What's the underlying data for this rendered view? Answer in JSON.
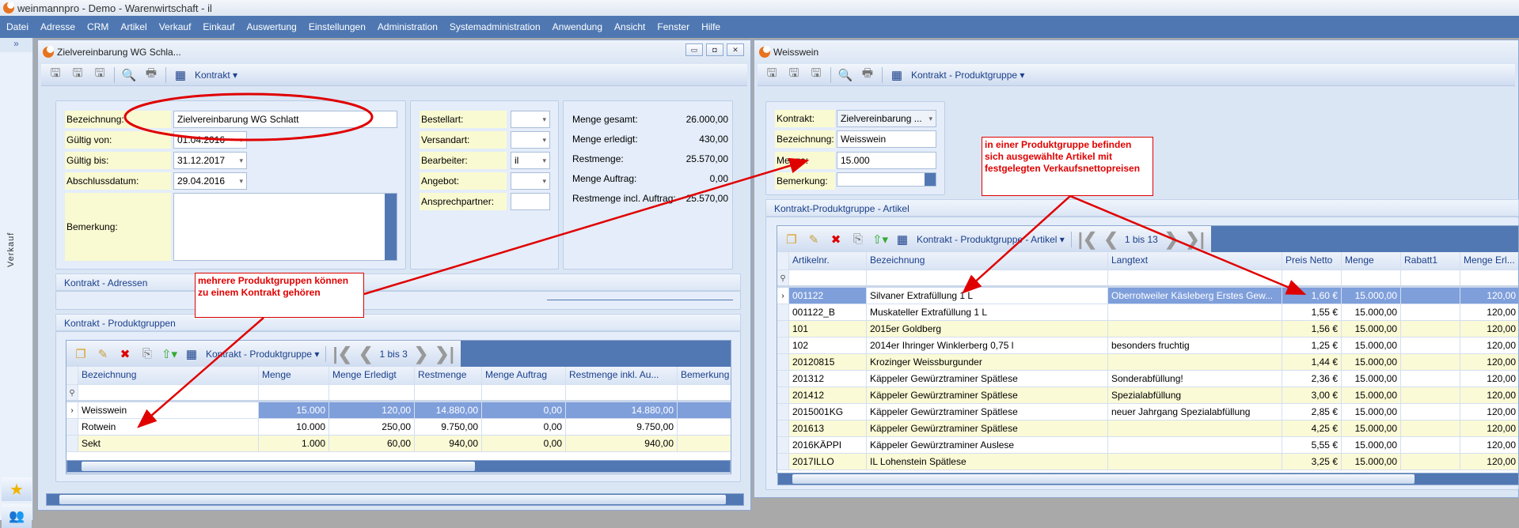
{
  "app": {
    "title": "weinmannpro - Demo - Warenwirtschaft - il"
  },
  "menu": [
    "Datei",
    "Adresse",
    "CRM",
    "Artikel",
    "Verkauf",
    "Einkauf",
    "Auswertung",
    "Einstellungen",
    "Administration",
    "Systemadministration",
    "Anwendung",
    "Ansicht",
    "Fenster",
    "Hilfe"
  ],
  "sidebar": {
    "expand": "»",
    "label": "Verkauf"
  },
  "colors": {
    "menubar": "#4f78b2",
    "selected_row": "#7f9fdb",
    "label_bg": "#fafad2",
    "annotation": "#e00000"
  },
  "left_window": {
    "title": "Zielvereinbarung WG Schla...",
    "toolbar_view": "Kontrakt",
    "form": {
      "bezeichnung_label": "Bezeichnung:",
      "bezeichnung": "Zielvereinbarung WG Schlatt",
      "gueltig_von_label": "Gültig von:",
      "gueltig_von": "01.04.2016",
      "gueltig_bis_label": "Gültig bis:",
      "gueltig_bis": "31.12.2017",
      "abschluss_label": "Abschlussdatum:",
      "abschluss": "29.04.2016",
      "bemerkung_label": "Bemerkung:"
    },
    "form2": {
      "bestellart": "Bestellart:",
      "versandart": "Versandart:",
      "bearbeiter": "Bearbeiter:",
      "bearbeiter_value": "il",
      "angebot": "Angebot:",
      "ansprechpartner": "Ansprechpartner:"
    },
    "summary": [
      {
        "label": "Menge gesamt:",
        "value": "26.000,00"
      },
      {
        "label": "Menge erledigt:",
        "value": "430,00"
      },
      {
        "label": "Restmenge:",
        "value": "25.570,00"
      },
      {
        "label": "Menge Auftrag:",
        "value": "0,00"
      },
      {
        "label": "Restmenge incl. Auftrag:",
        "value": "25.570,00"
      }
    ],
    "adressen_header": "Kontrakt - Adressen",
    "produktgruppen_header": "Kontrakt - Produktgruppen",
    "grid_view": "Kontrakt - Produktgruppe",
    "grid_paging": "1 bis 3",
    "columns": [
      "Bezeichnung",
      "Menge",
      "Menge Erledigt",
      "Restmenge",
      "Menge Auftrag",
      "Restmenge inkl. Au...",
      "Bemerkung"
    ],
    "rows": [
      [
        "Weisswein",
        "15.000",
        "120,00",
        "14.880,00",
        "0,00",
        "14.880,00",
        ""
      ],
      [
        "Rotwein",
        "10.000",
        "250,00",
        "9.750,00",
        "0,00",
        "9.750,00",
        ""
      ],
      [
        "Sekt",
        "1.000",
        "60,00",
        "940,00",
        "0,00",
        "940,00",
        ""
      ]
    ]
  },
  "right_window": {
    "title": "Weisswein",
    "toolbar_view": "Kontrakt - Produktgruppe",
    "form": {
      "kontrakt_label": "Kontrakt:",
      "kontrakt": "Zielvereinbarung ...",
      "bezeichnung_label": "Bezeichnung:",
      "bezeichnung": "Weisswein",
      "menge_label": "Menge:",
      "menge": "15.000",
      "bemerkung_label": "Bemerkung:"
    },
    "section_header": "Kontrakt-Produktgruppe - Artikel",
    "grid_view": "Kontrakt - Produktgruppe - Artikel",
    "grid_paging": "1 bis 13",
    "columns": [
      "Artikelnr.",
      "Bezeichnung",
      "Langtext",
      "Preis Netto",
      "Menge",
      "Rabatt1",
      "Menge Erl..."
    ],
    "rows": [
      [
        "001122",
        "Silvaner Extrafüllung 1 L",
        "Oberrotweiler Käsleberg Erstes Gew...",
        "1,60 €",
        "15.000,00",
        "",
        "120,00"
      ],
      [
        "001122_B",
        "Muskateller Extrafüllung 1 L",
        "",
        "1,55 €",
        "15.000,00",
        "",
        "120,00"
      ],
      [
        "101",
        "2015er Goldberg",
        "",
        "1,56 €",
        "15.000,00",
        "",
        "120,00"
      ],
      [
        "102",
        "2014er Ihringer Winklerberg 0,75 l",
        "besonders fruchtig",
        "1,25 €",
        "15.000,00",
        "",
        "120,00"
      ],
      [
        "20120815",
        "Krozinger Weissburgunder",
        "",
        "1,44 €",
        "15.000,00",
        "",
        "120,00"
      ],
      [
        "201312",
        "Käppeler Gewürztraminer Spätlese",
        "Sonderabfüllung!",
        "2,36 €",
        "15.000,00",
        "",
        "120,00"
      ],
      [
        "201412",
        "Käppeler Gewürztraminer Spätlese",
        "Spezialabfüllung",
        "3,00 €",
        "15.000,00",
        "",
        "120,00"
      ],
      [
        "2015001KG",
        "Käppeler Gewürztraminer Spätlese",
        "neuer Jahrgang Spezialabfüllung",
        "2,85 €",
        "15.000,00",
        "",
        "120,00"
      ],
      [
        "201613",
        "Käppeler Gewürztraminer Spätlese",
        "",
        "4,25 €",
        "15.000,00",
        "",
        "120,00"
      ],
      [
        "2016KÄPPI",
        "Käppeler Gewürztraminer Auslese",
        "",
        "5,55 €",
        "15.000,00",
        "",
        "120,00"
      ],
      [
        "2017ILLO",
        "IL Lohenstein Spätlese",
        "",
        "3,25 €",
        "15.000,00",
        "",
        "120,00"
      ]
    ]
  },
  "annotations": {
    "left": "mehrere Produktgruppen können zu einem Kontrakt gehören",
    "right": "in einer Produktgruppe befinden sich ausgewählte Artikel mit festgelegten Verkaufsnettopreisen"
  }
}
